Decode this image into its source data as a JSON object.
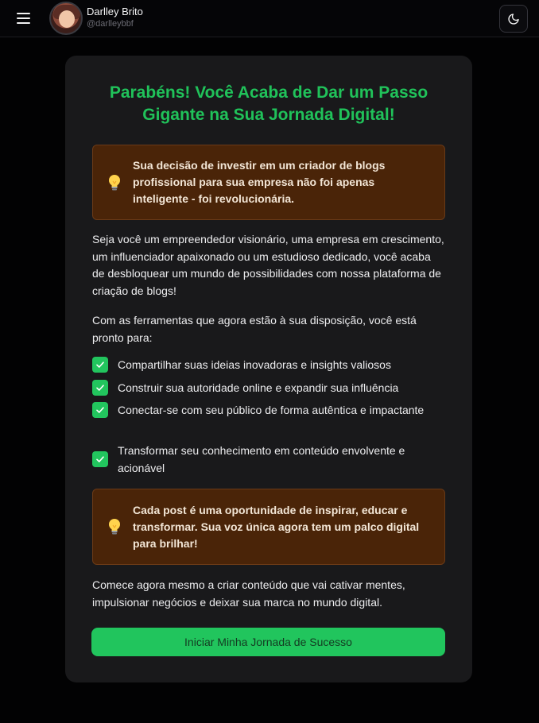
{
  "header": {
    "user_name": "Darlley Brito",
    "user_handle": "@darlleybbf",
    "menu_icon": "hamburger-menu-icon",
    "theme_icon": "moon-icon"
  },
  "card": {
    "title": "Parabéns! Você Acaba de Dar um Passo Gigante na Sua Jornada Digital!",
    "callout_1": "Sua decisão de investir em um criador de blogs profissional para sua empresa não foi apenas inteligente - foi revolucionária.",
    "paragraph_1": "Seja você um empreendedor visionário, uma empresa em crescimento, um influenciador apaixonado ou um estudioso dedicado, você acaba de desbloquear um mundo de possibilidades com nossa plataforma de criação de blogs!",
    "paragraph_2": "Com as ferramentas que agora estão à sua disposição, você está pronto para:",
    "checklist": [
      "Compartilhar suas ideias inovadoras e insights valiosos",
      "Construir sua autoridade online e expandir sua influência",
      "Conectar-se com seu público de forma autêntica e impactante",
      "Transformar seu conhecimento em conteúdo envolvente e acionável"
    ],
    "callout_2": "Cada post é uma oportunidade de inspirar, educar e transformar. Sua voz única agora tem um palco digital para brilhar!",
    "paragraph_3": "Comece agora mesmo a criar conteúdo que vai cativar mentes, impulsionar negócios e deixar sua marca no mundo digital.",
    "cta_label": "Iniciar Minha Jornada de Sucesso"
  },
  "colors": {
    "background": "#020203",
    "card": "#19191b",
    "accent_green": "#22c55e",
    "callout_bg": "#4a2408"
  }
}
